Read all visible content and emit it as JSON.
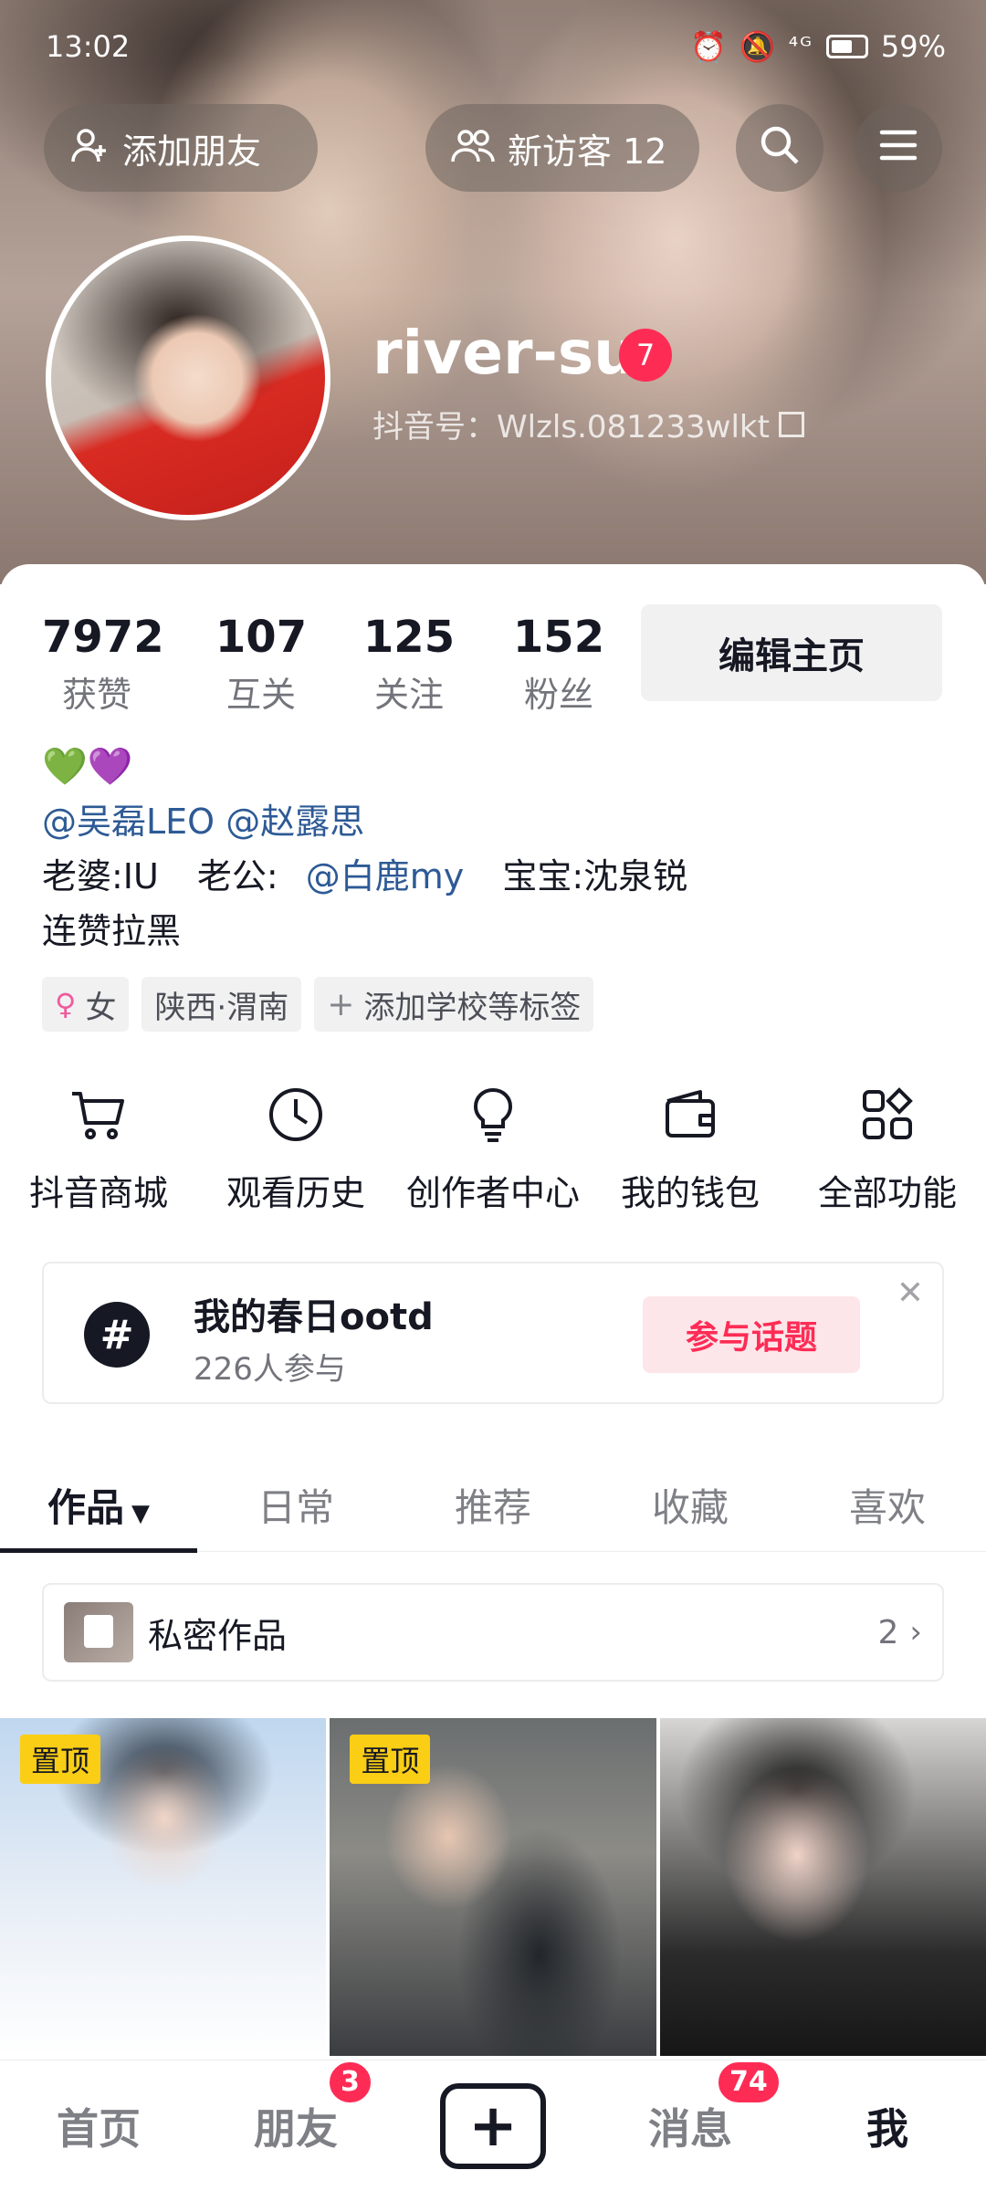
{
  "status_bar": {
    "time": "13:02",
    "signal": "⁴ᴳ",
    "battery": "59%"
  },
  "header": {
    "add_friend": "添加朋友",
    "new_visitors": "新访客 12",
    "icons": [
      "person-add-icon",
      "group-icon",
      "search-icon",
      "menu-icon"
    ]
  },
  "profile": {
    "username": "river-su",
    "level": "7",
    "douyin_id": "抖音号：Wlzls.081233wlkt"
  },
  "stats": [
    {
      "value": "7972",
      "label": "获赞"
    },
    {
      "value": "107",
      "label": "互关"
    },
    {
      "value": "125",
      "label": "关注"
    },
    {
      "value": "152",
      "label": "粉丝"
    }
  ],
  "edit_button": "编辑主页",
  "bio": {
    "emoji": "💚💜",
    "mention1": "@吴磊LEO",
    "mention2": "@赵露思",
    "wife": "老婆:IU",
    "husband_prefix": "老公:",
    "husband_mention": "@白鹿my",
    "baby": "宝宝:沈泉锐",
    "last_line": "连赞拉黑"
  },
  "tags": {
    "gender_symbol": "♀",
    "gender": "女",
    "location": "陕西·渭南",
    "add_tag": "添加学校等标签"
  },
  "features": [
    {
      "label": "抖音商城",
      "icon": "cart-icon"
    },
    {
      "label": "观看历史",
      "icon": "clock-icon"
    },
    {
      "label": "创作者中心",
      "icon": "lightbulb-icon"
    },
    {
      "label": "我的钱包",
      "icon": "wallet-icon"
    },
    {
      "label": "全部功能",
      "icon": "apps-icon"
    }
  ],
  "topic": {
    "title": "我的春日ootd",
    "participants": "226人参与",
    "join": "参与话题"
  },
  "tabs": [
    "作品",
    "日常",
    "推荐",
    "收藏",
    "喜欢"
  ],
  "private_works": {
    "label": "私密作品",
    "count": "2"
  },
  "videos": [
    {
      "pinned": "置顶"
    },
    {
      "pinned": "置顶"
    },
    {
      "pinned": ""
    }
  ],
  "bottom_nav": {
    "home": "首页",
    "friends": "朋友",
    "friends_badge": "3",
    "messages": "消息",
    "messages_badge": "74",
    "me": "我"
  },
  "colors": {
    "accent": "#fe2c55",
    "mention": "#2d5a95",
    "pin": "#face15"
  }
}
